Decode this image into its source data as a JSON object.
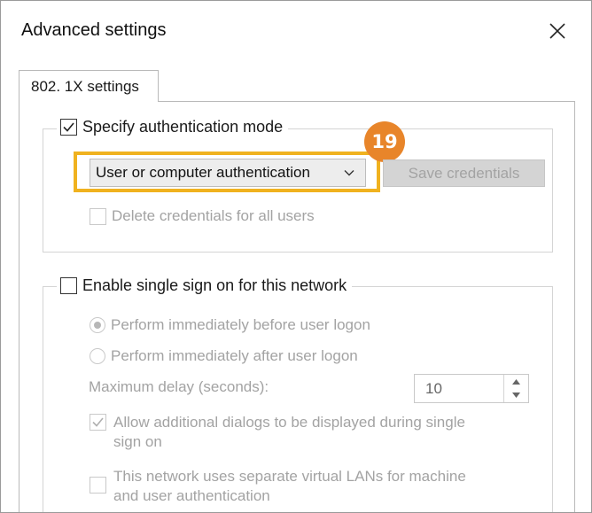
{
  "window": {
    "title": "Advanced settings"
  },
  "tabs": [
    {
      "label": "802. 1X settings"
    }
  ],
  "auth_group": {
    "specify_mode_label": "Specify authentication mode",
    "specify_mode_checked": true,
    "mode_select_value": "User or computer authentication",
    "save_credentials_label": "Save credentials",
    "delete_credentials_label": "Delete credentials for all users",
    "delete_credentials_checked": false
  },
  "annotation": {
    "badge_number": "19",
    "highlight_color": "#f0b21f",
    "badge_color": "#e8852a"
  },
  "sso_group": {
    "enable_label": "Enable single sign on for this network",
    "enable_checked": false,
    "radio_before_label": "Perform immediately before user logon",
    "radio_before_selected": true,
    "radio_after_label": "Perform immediately after user logon",
    "max_delay_label": "Maximum delay (seconds):",
    "max_delay_value": "10",
    "allow_dialogs_label_line1": "Allow additional dialogs to be displayed during single",
    "allow_dialogs_label_line2": "sign on",
    "allow_dialogs_checked": true,
    "separate_vlans_label_line1": "This network uses separate virtual LANs for machine",
    "separate_vlans_label_line2": "and user authentication",
    "separate_vlans_checked": false
  }
}
